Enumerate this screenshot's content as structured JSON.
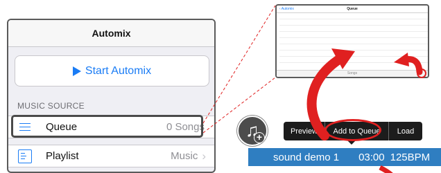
{
  "automix": {
    "title": "Automix",
    "start_button": "Start Automix",
    "section_label": "MUSIC SOURCE",
    "rows": [
      {
        "label": "Queue",
        "detail": "0 Songs",
        "icon": "queue-icon"
      },
      {
        "label": "Playlist",
        "detail": "Music",
        "icon": "playlist-icon"
      }
    ]
  },
  "queue_preview": {
    "back_label": "Automix",
    "title": "Queue",
    "footer_text": "Songs"
  },
  "context_menu": {
    "items": [
      "Preview",
      "Add to Queue",
      "Load"
    ]
  },
  "track": {
    "name": "sound demo 1",
    "time": "03:00",
    "bpm": "125BPM"
  },
  "colors": {
    "accent": "#1a7cf5",
    "highlight_red": "#e02020",
    "track_bar": "#2f7ec1",
    "menu_bg": "#1c1c1c"
  },
  "icons": [
    "play-icon",
    "queue-icon",
    "playlist-icon",
    "chevron-right-icon",
    "music-note-icon",
    "plus-icon"
  ]
}
